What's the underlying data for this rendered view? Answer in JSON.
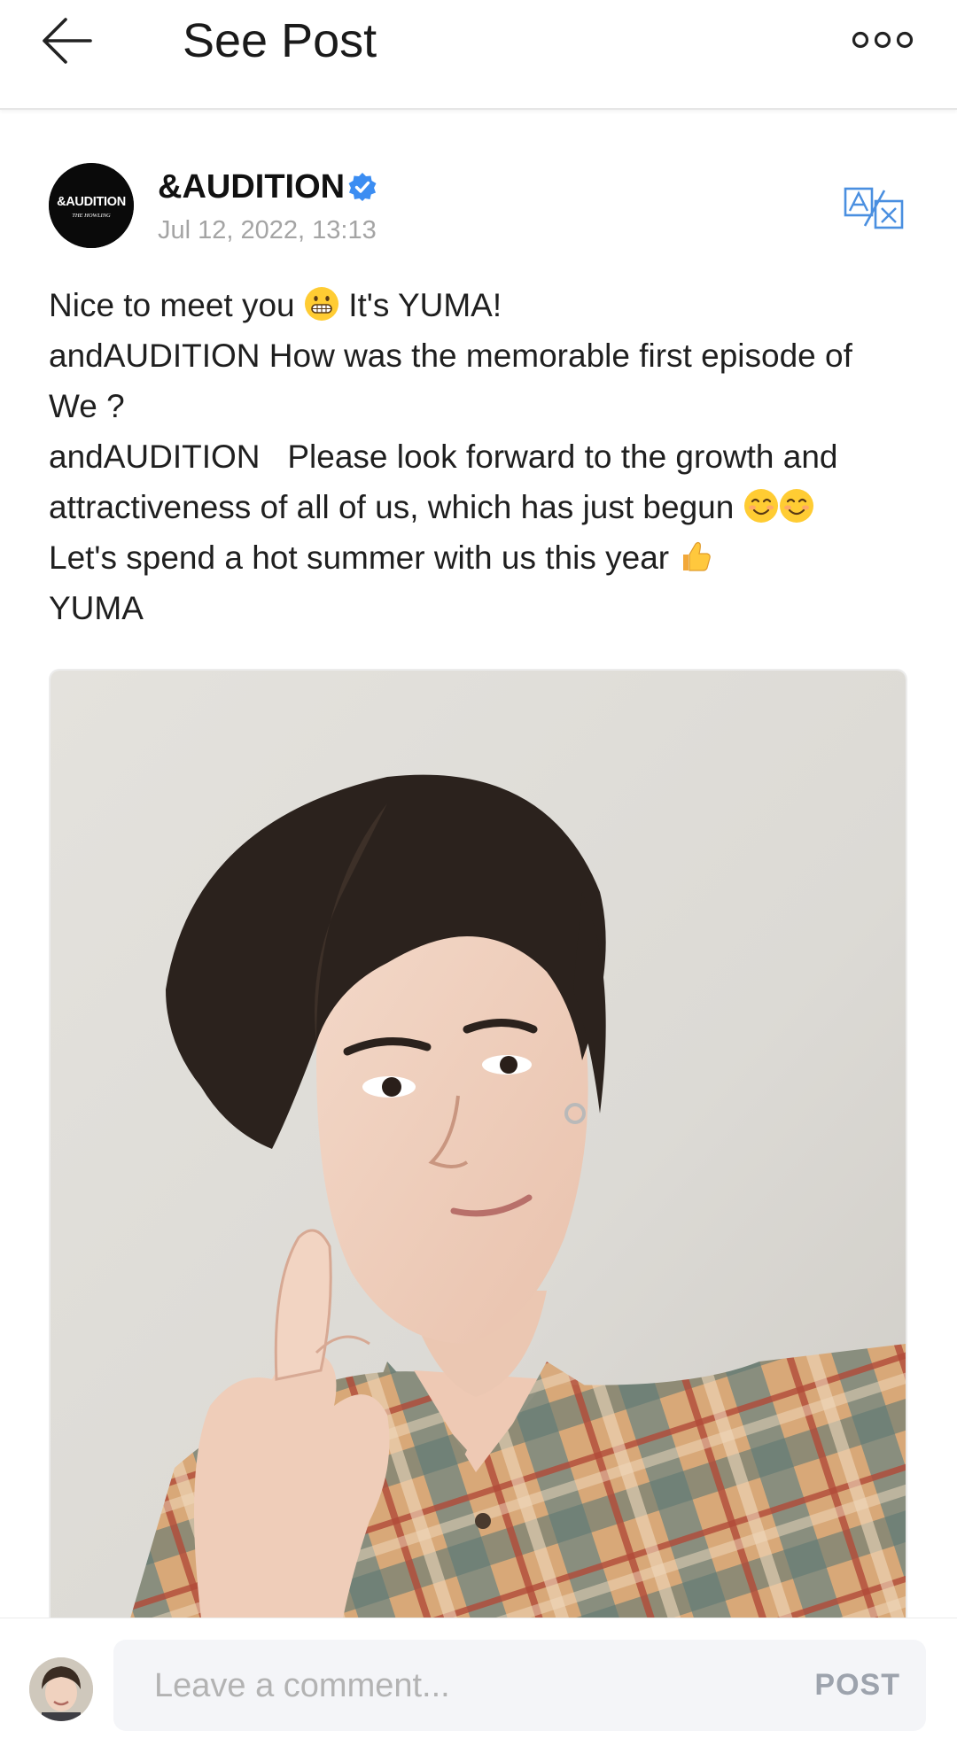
{
  "header": {
    "title": "See Post",
    "back_icon": "arrow-left-icon",
    "more_icon": "more-horizontal-icon"
  },
  "post": {
    "author": {
      "name": "&AUDITION",
      "avatar_logo_text": "&AUDITION",
      "avatar_logo_subtext": "THE HOWLING",
      "verified_icon": "verified-badge-icon"
    },
    "timestamp": "Jul 12, 2022, 13:13",
    "translate_icon": "translate-icon",
    "body_lines": [
      {
        "text_a": "Nice to meet you",
        "text_b": "It's YUMA!"
      },
      "andAUDITION How was the memorable first episode of",
      "We ?",
      "andAUDITION   Please look forward to the growth and",
      {
        "text": "attractiveness of all of us, which has just begun"
      },
      {
        "text": "Let's spend a hot summer with us this year"
      },
      "YUMA"
    ],
    "image_alt": "Selfie of YUMA making a finger heart, wearing a plaid shirt"
  },
  "comment_bar": {
    "placeholder": "Leave a comment...",
    "post_label": "POST"
  },
  "colors": {
    "verified": "#3b8df2",
    "translate": "#4a8fe0",
    "date_gray": "#a4a4a4",
    "post_button": "#9da3ad",
    "field_bg": "#f4f5f8"
  }
}
